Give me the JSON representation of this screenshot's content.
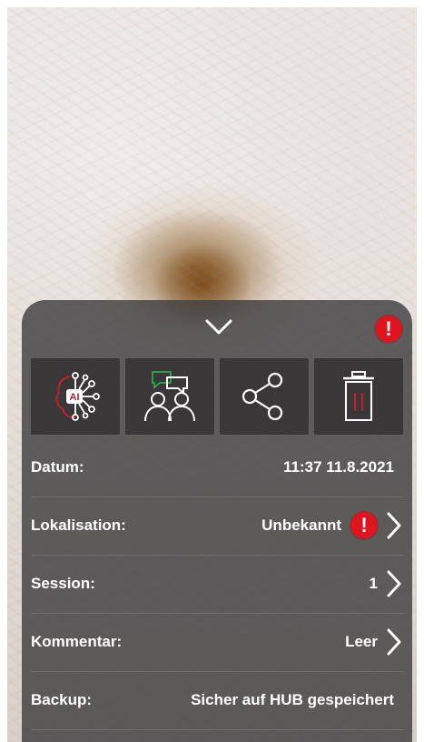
{
  "sheet": {
    "alert_symbol": "!",
    "actions": [
      {
        "name": "ai-analysis",
        "icon": "ai-brain-icon",
        "label": "AI"
      },
      {
        "name": "consult",
        "icon": "consultation-icon"
      },
      {
        "name": "share",
        "icon": "share-icon"
      },
      {
        "name": "delete",
        "icon": "trash-icon"
      }
    ],
    "rows": {
      "datum": {
        "label": "Datum:",
        "value": "11:37 11.8.2021"
      },
      "lokalisation": {
        "label": "Lokalisation:",
        "value": "Unbekannt",
        "alert": "!"
      },
      "session": {
        "label": "Session:",
        "value": "1"
      },
      "kommentar": {
        "label": "Kommentar:",
        "value": "Leer"
      },
      "backup": {
        "label": "Backup:",
        "value": "Sicher auf HUB gespeichert"
      }
    }
  },
  "colors": {
    "panel": "#403e3f",
    "tile": "#3a3738",
    "alert": "#e0141e",
    "accent_red": "#b7232b",
    "accent_green": "#2e9a4b"
  }
}
